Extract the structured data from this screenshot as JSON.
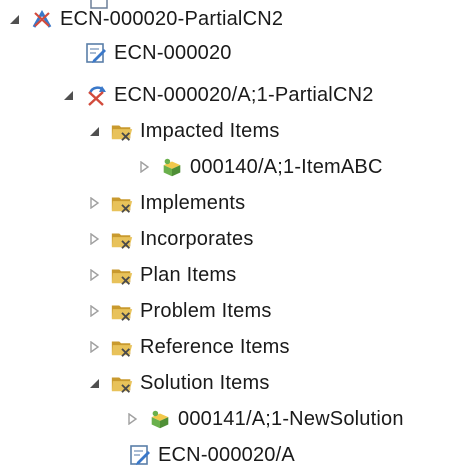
{
  "tree": {
    "items": [
      {
        "label": "",
        "icon": "document-icon"
      },
      {
        "label": "ECN-000020-PartialCN2",
        "icon": "change-notice-icon",
        "toggle": "expanded"
      },
      {
        "label": "ECN-000020",
        "icon": "document-edit-icon"
      },
      {
        "label": "ECN-000020/A;1-PartialCN2",
        "icon": "change-notice-revision-icon",
        "toggle": "expanded"
      },
      {
        "label": "Impacted Items",
        "icon": "folder-icon",
        "toggle": "expanded"
      },
      {
        "label": "000140/A;1-ItemABC",
        "icon": "item-icon",
        "toggle": "collapsed"
      },
      {
        "label": "Implements",
        "icon": "folder-icon",
        "toggle": "collapsed"
      },
      {
        "label": "Incorporates",
        "icon": "folder-icon",
        "toggle": "collapsed"
      },
      {
        "label": "Plan Items",
        "icon": "folder-icon",
        "toggle": "collapsed"
      },
      {
        "label": "Problem Items",
        "icon": "folder-icon",
        "toggle": "collapsed"
      },
      {
        "label": "Reference Items",
        "icon": "folder-icon",
        "toggle": "collapsed"
      },
      {
        "label": "Solution Items",
        "icon": "folder-icon",
        "toggle": "expanded"
      },
      {
        "label": "000141/A;1-NewSolution",
        "icon": "item-icon",
        "toggle": "collapsed"
      },
      {
        "label": "ECN-000020/A",
        "icon": "document-edit-icon"
      }
    ]
  },
  "colors": {
    "expander": "#505050",
    "collapsed_expander": "#a0a0a0",
    "folder": "#e8c25a",
    "folder_dark": "#c99a2e",
    "item_green": "#6ab04c",
    "item_yellow": "#f2c84b",
    "cn_red": "#d24b3c",
    "cn_blue": "#3a78c9"
  }
}
